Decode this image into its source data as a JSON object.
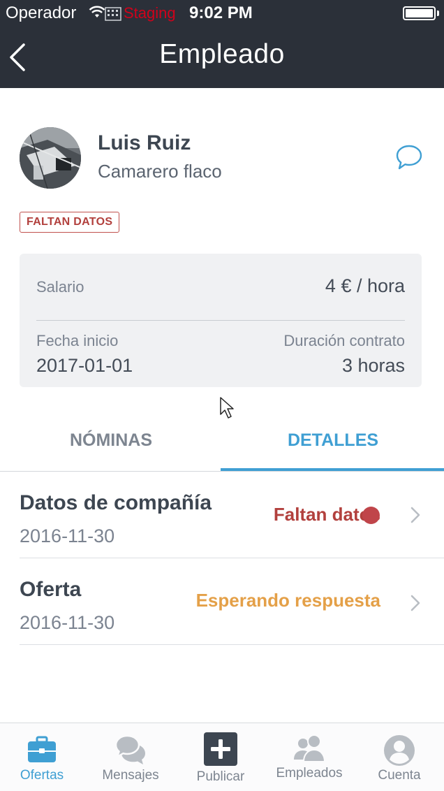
{
  "status_bar": {
    "carrier": "Operador",
    "environment": "Staging",
    "time": "9:02 PM",
    "battery_level": 1.0
  },
  "nav": {
    "title": "Empleado"
  },
  "employee": {
    "name": "Luis Ruiz",
    "role": "Camarero flaco",
    "badge": "FALTAN DATOS"
  },
  "info_card": {
    "salary_label": "Salario",
    "salary_value": "4 € / hora",
    "start_label": "Fecha inicio",
    "start_value": "2017-01-01",
    "duration_label": "Duración contrato",
    "duration_value": "3 horas"
  },
  "tabs": [
    {
      "label": "NÓMINAS",
      "active": false
    },
    {
      "label": "DETALLES",
      "active": true
    }
  ],
  "details": [
    {
      "title": "Datos de compañía",
      "date": "2016-11-30",
      "status": "Faltan datos",
      "status_color": "#b2403d"
    },
    {
      "title": "Oferta",
      "date": "2016-11-30",
      "status": "Esperando respuesta",
      "status_color": "#e4a048"
    }
  ],
  "tab_bar": {
    "items": [
      {
        "label": "Ofertas",
        "icon": "briefcase-icon",
        "active": true
      },
      {
        "label": "Mensajes",
        "icon": "chat-bubbles-icon",
        "active": false
      },
      {
        "label": "Publicar",
        "icon": "plus-square-icon",
        "active": false
      },
      {
        "label": "Empleados",
        "icon": "people-icon",
        "active": false
      },
      {
        "label": "Cuenta",
        "icon": "user-icon",
        "active": false
      }
    ]
  },
  "colors": {
    "header": "#2b3039",
    "accent": "#3f9fd3",
    "alert": "#b2403d",
    "pending": "#e4a048"
  }
}
